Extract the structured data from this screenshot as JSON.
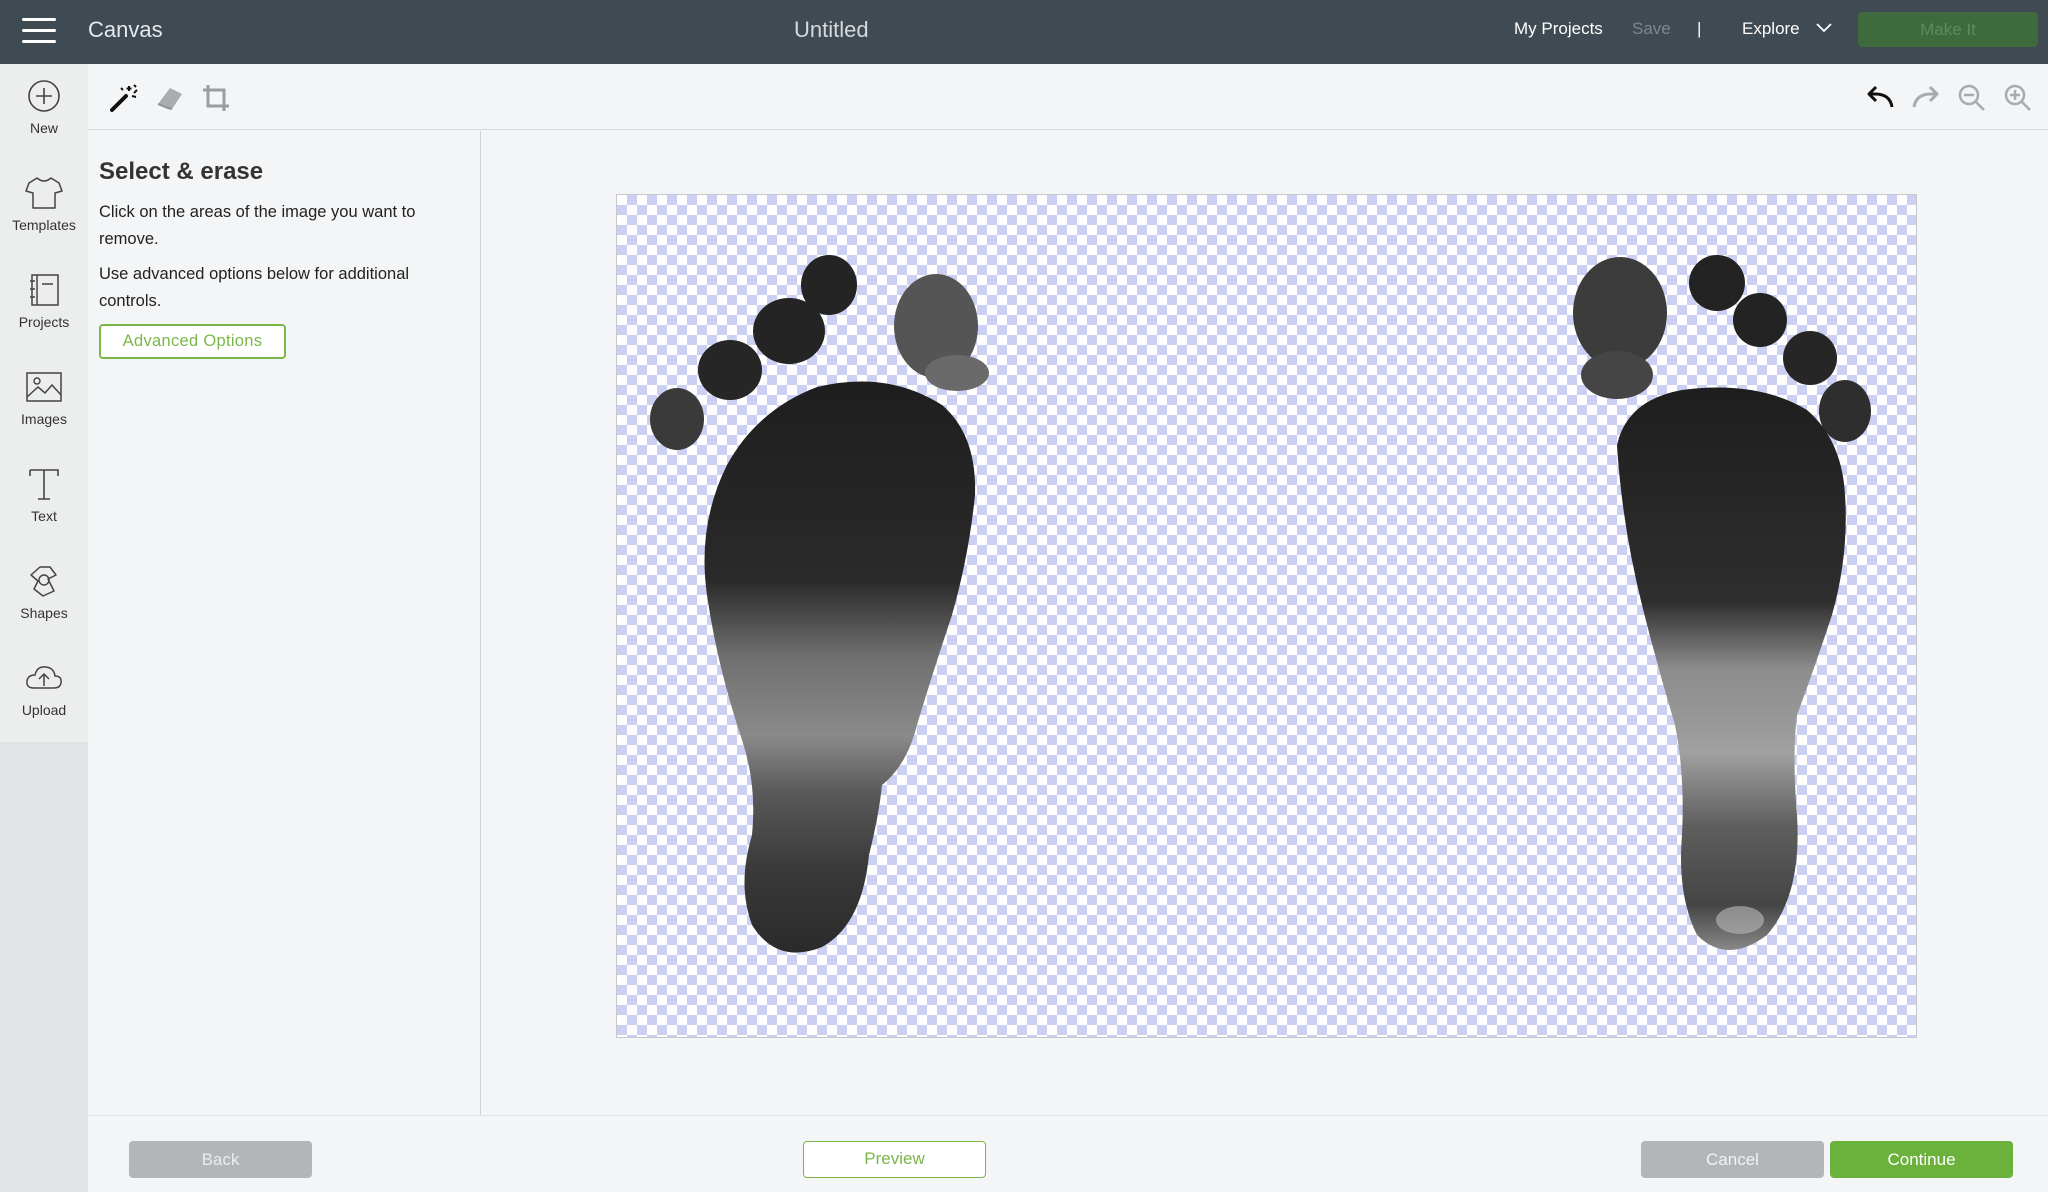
{
  "header": {
    "app_title": "Canvas",
    "doc_title": "Untitled",
    "my_projects": "My Projects",
    "save": "Save",
    "separator": "|",
    "explore": "Explore",
    "make_it": "Make It"
  },
  "sidebar": {
    "items": [
      {
        "label": "New",
        "icon": "plus-circle-icon"
      },
      {
        "label": "Templates",
        "icon": "tshirt-icon"
      },
      {
        "label": "Projects",
        "icon": "book-icon"
      },
      {
        "label": "Images",
        "icon": "image-icon"
      },
      {
        "label": "Text",
        "icon": "text-t-icon"
      },
      {
        "label": "Shapes",
        "icon": "shapes-icon"
      },
      {
        "label": "Upload",
        "icon": "cloud-upload-icon"
      }
    ]
  },
  "toolbar": {
    "tools": [
      "magic-wand-icon",
      "eraser-icon",
      "crop-icon"
    ],
    "actions": [
      "undo-icon",
      "redo-icon",
      "zoom-out-icon",
      "zoom-in-icon"
    ]
  },
  "panel": {
    "title": "Select & erase",
    "p1": "Click on the areas of the image you want to remove.",
    "p2": "Use advanced options below for additional controls.",
    "advanced": "Advanced Options"
  },
  "footer": {
    "back": "Back",
    "preview": "Preview",
    "cancel": "Cancel",
    "continue": "Continue"
  },
  "colors": {
    "topbar": "#3f4a52",
    "accent_green": "#7ab648",
    "checker": "#ccd0f2"
  }
}
